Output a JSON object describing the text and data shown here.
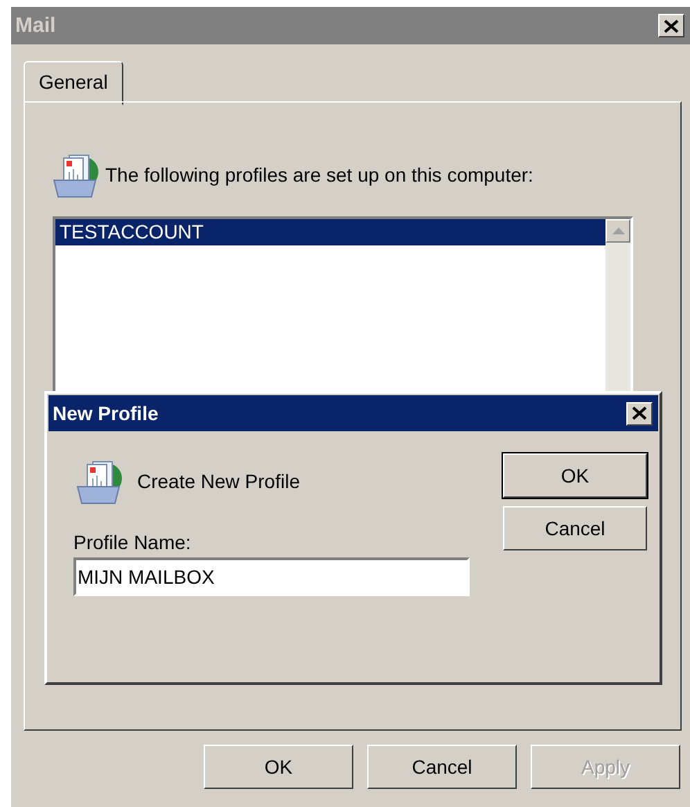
{
  "window": {
    "title": "Mail",
    "active": false
  },
  "tabs": [
    {
      "label": "General",
      "selected": true
    }
  ],
  "intro": "The following profiles are set up on this computer:",
  "profiles": [
    {
      "name": "TESTACCOUNT",
      "selected": true
    }
  ],
  "dialog": {
    "title": "New Profile",
    "heading": "Create New Profile",
    "field_label": "Profile Name:",
    "field_value": "MIJN MAILBOX",
    "buttons": [
      {
        "label": "OK",
        "default": true
      },
      {
        "label": "Cancel",
        "default": false
      }
    ]
  },
  "buttons": [
    {
      "label": "OK",
      "disabled": false
    },
    {
      "label": "Cancel",
      "disabled": false
    },
    {
      "label": "Apply",
      "disabled": true
    }
  ]
}
